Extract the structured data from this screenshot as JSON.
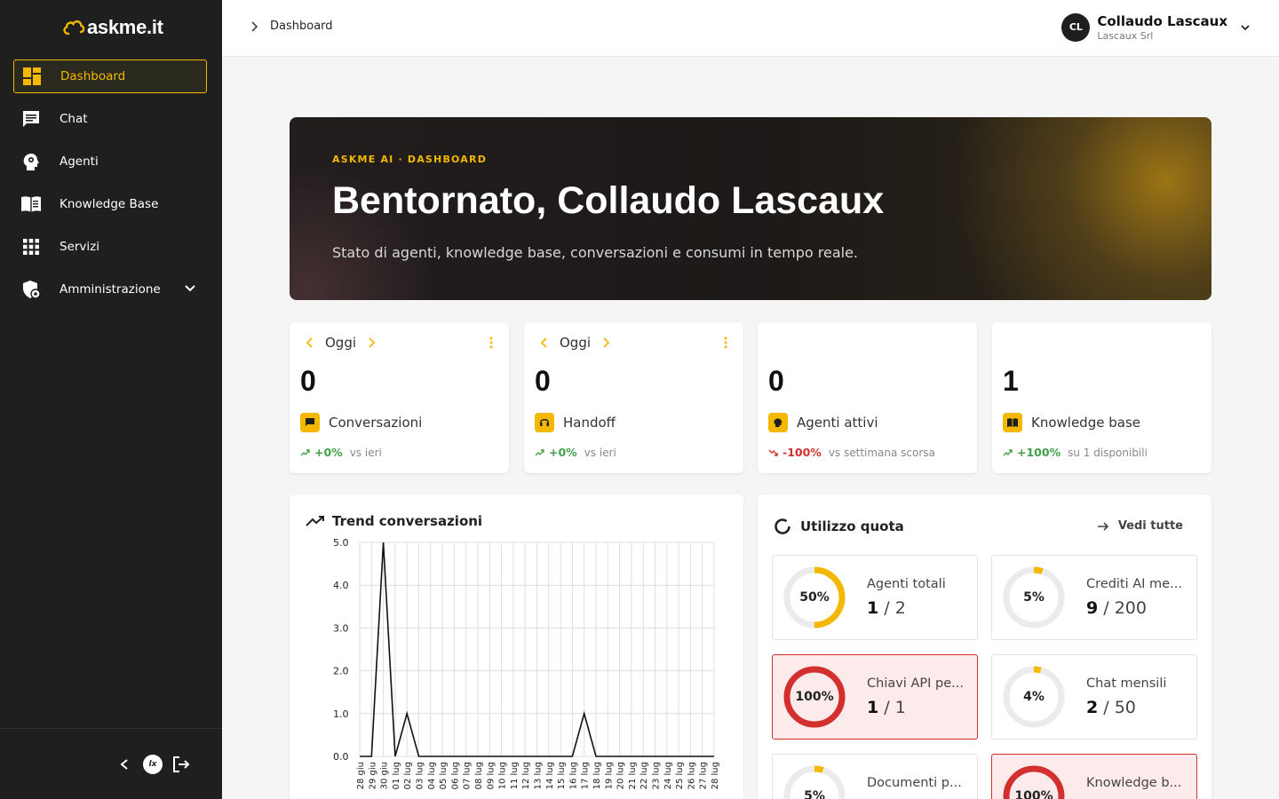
{
  "app": {
    "logo_text": "askme.it"
  },
  "sidebar": {
    "items": [
      {
        "label": "Dashboard",
        "icon": "dashboard-icon",
        "active": true
      },
      {
        "label": "Chat",
        "icon": "chat-icon"
      },
      {
        "label": "Agenti",
        "icon": "agent-head-icon"
      },
      {
        "label": "Knowledge Base",
        "icon": "book-icon"
      },
      {
        "label": "Servizi",
        "icon": "grid-icon"
      },
      {
        "label": "Amministrazione",
        "icon": "shield-gear-icon",
        "expandable": true
      }
    ],
    "footer": {
      "collapse_icon": "chevron-left-icon",
      "brand_icon": "lx-badge-icon",
      "brand_badge_text": "lx",
      "logout_icon": "logout-icon"
    }
  },
  "header": {
    "breadcrumb": "Dashboard",
    "user": {
      "initials": "CL",
      "name": "Collaudo Lascaux",
      "org": "Lascaux Srl"
    }
  },
  "hero": {
    "kicker": "ASKME AI · DASHBOARD",
    "title": "Bentornato, Collaudo Lascaux",
    "subtitle": "Stato di agenti, knowledge base, conversazioni e consumi in tempo reale."
  },
  "stats": [
    {
      "period": "Oggi",
      "value": "0",
      "label": "Conversazioni",
      "icon": "chat-icon",
      "trend": "+0%",
      "trend_dir": "up",
      "compare": "vs ieri"
    },
    {
      "period": "Oggi",
      "value": "0",
      "label": "Handoff",
      "icon": "headset-icon",
      "trend": "+0%",
      "trend_dir": "up",
      "compare": "vs ieri"
    },
    {
      "value": "0",
      "label": "Agenti attivi",
      "icon": "agent-head-icon",
      "trend": "-100%",
      "trend_dir": "down",
      "compare": "vs settimana scorsa"
    },
    {
      "value": "1",
      "label": "Knowledge base",
      "icon": "book-icon",
      "trend": "+100%",
      "trend_dir": "up",
      "compare": "su 1 disponibili"
    }
  ],
  "trend_card": {
    "title": "Trend conversazioni"
  },
  "chart_data": {
    "type": "line",
    "title": "Trend conversazioni",
    "x": [
      "28 giu",
      "29 giu",
      "30 giu",
      "01 lug",
      "02 lug",
      "03 lug",
      "04 lug",
      "05 lug",
      "06 lug",
      "07 lug",
      "08 lug",
      "09 lug",
      "10 lug",
      "11 lug",
      "12 lug",
      "13 lug",
      "14 lug",
      "15 lug",
      "16 lug",
      "17 lug",
      "18 lug",
      "19 lug",
      "20 lug",
      "21 lug",
      "22 lug",
      "23 lug",
      "24 lug",
      "25 lug",
      "26 lug",
      "27 lug",
      "28 lug"
    ],
    "values": [
      0,
      0,
      5,
      0,
      1,
      0,
      0,
      0,
      0,
      0,
      0,
      0,
      0,
      0,
      0,
      0,
      0,
      0,
      0,
      1,
      0,
      0,
      0,
      0,
      0,
      0,
      0,
      0,
      0,
      0,
      0
    ],
    "yticks": [
      "0.0",
      "1.0",
      "2.0",
      "3.0",
      "4.0",
      "5.0"
    ],
    "ylim": [
      0,
      5
    ],
    "grid": true,
    "color": "#111111"
  },
  "quota": {
    "title": "Utilizzo quota",
    "view_all": "Vedi tutte",
    "items": [
      {
        "name": "Agenti totali",
        "used": "1",
        "total": "2",
        "pct": 50,
        "pct_label": "50%",
        "full": false
      },
      {
        "name": "Crediti AI me...",
        "used": "9",
        "total": "200",
        "pct": 5,
        "pct_label": "5%",
        "full": false
      },
      {
        "name": "Chiavi API pe...",
        "used": "1",
        "total": "1",
        "pct": 100,
        "pct_label": "100%",
        "full": true
      },
      {
        "name": "Chat mensili",
        "used": "2",
        "total": "50",
        "pct": 4,
        "pct_label": "4%",
        "full": false
      },
      {
        "name": "Documenti p...",
        "used": "",
        "total": "",
        "pct": 5,
        "pct_label": "5%",
        "full": false
      },
      {
        "name": "Knowledge b...",
        "used": "",
        "total": "",
        "pct": 100,
        "pct_label": "100%",
        "full": true
      }
    ]
  },
  "colors": {
    "accent": "#f5b800",
    "danger": "#d32f2f",
    "success": "#43a047",
    "sidebar": "#1f1f1f"
  }
}
